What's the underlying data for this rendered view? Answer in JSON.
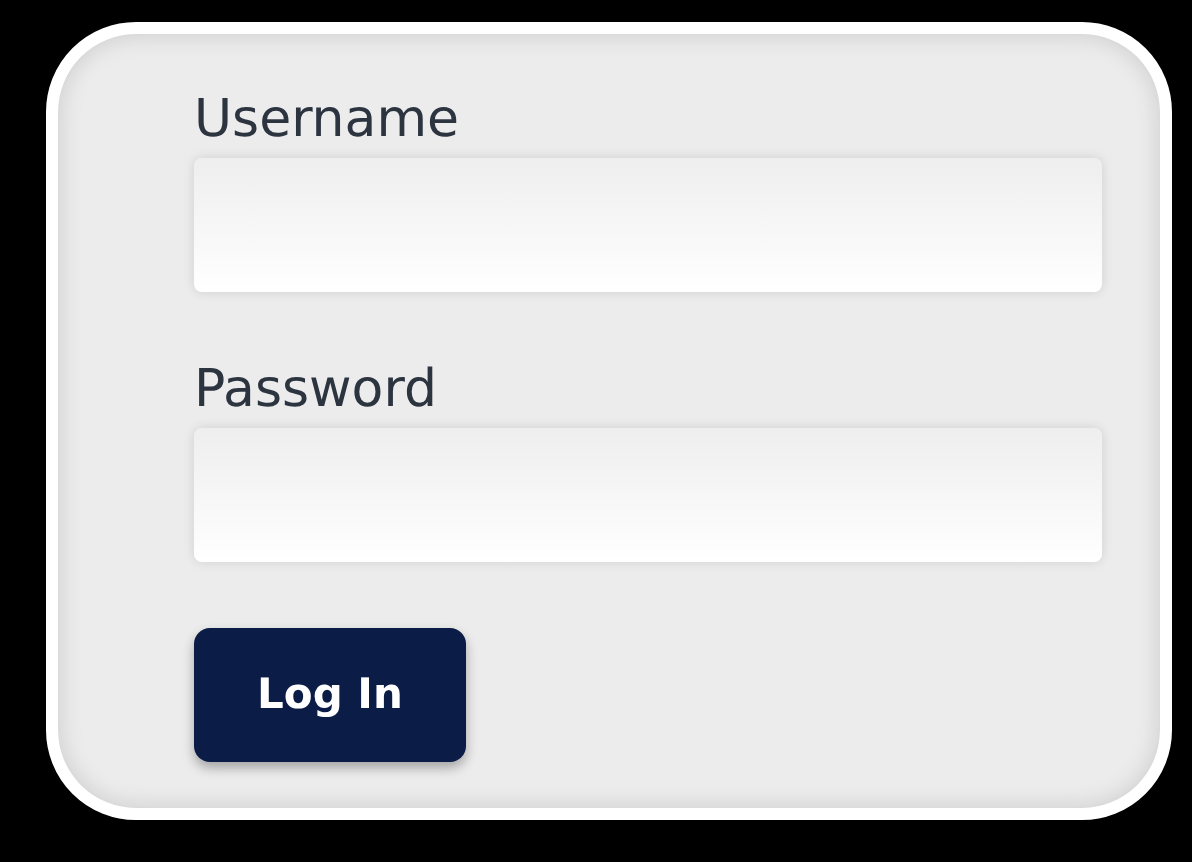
{
  "fields": [
    {
      "label": "Username"
    },
    {
      "label": "Password"
    }
  ],
  "button": {
    "label": "Log In"
  }
}
